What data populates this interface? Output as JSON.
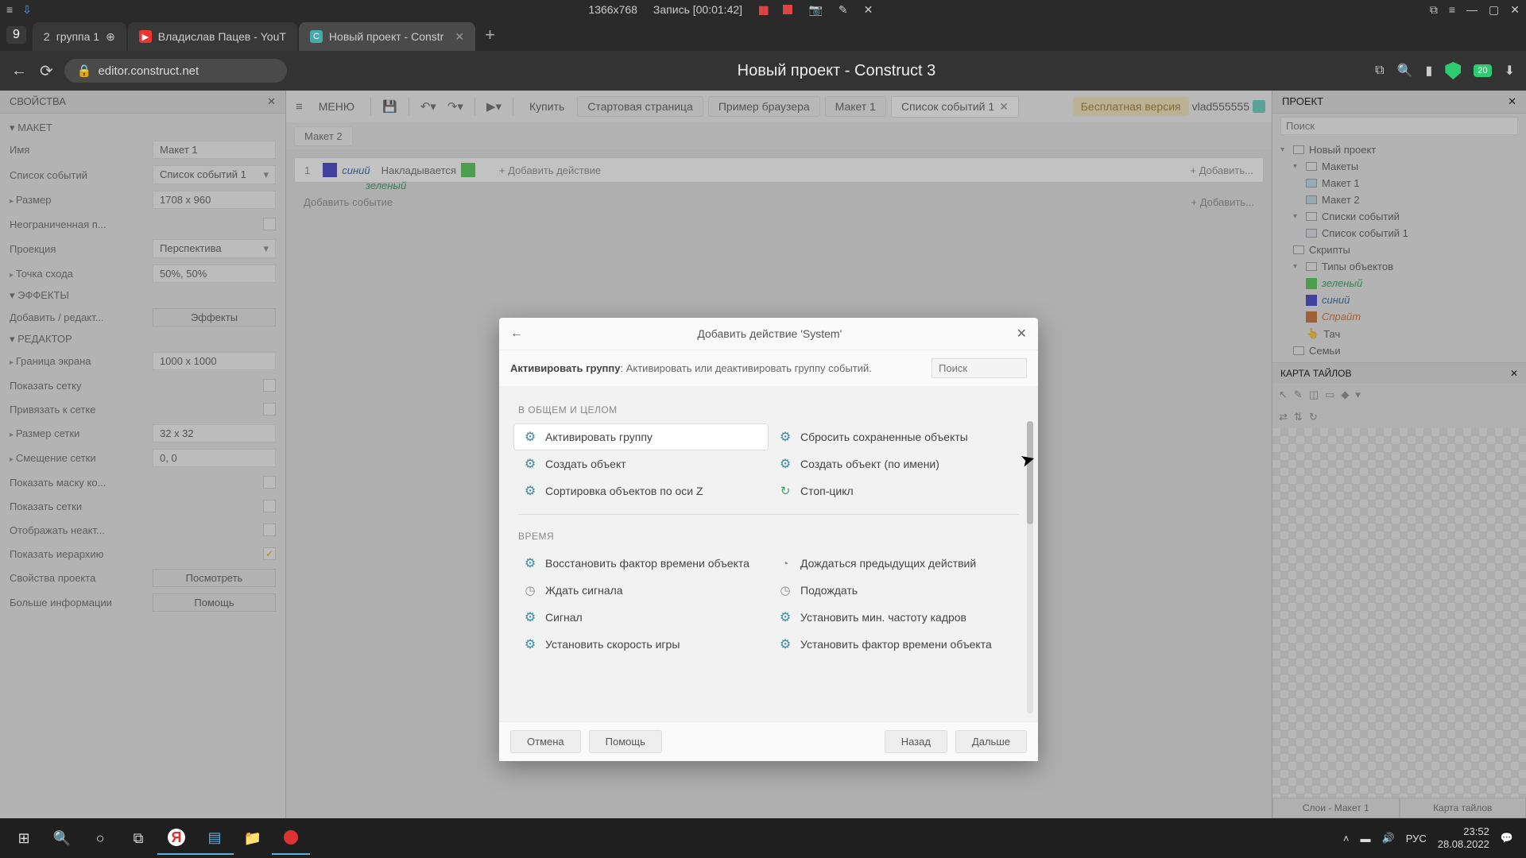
{
  "os": {
    "tabBadge": "9",
    "tabNumLabel": "2",
    "tabGroup": "группа 1",
    "resolution": "1366x768",
    "recordingLabel": "Запись [00:01:42]"
  },
  "browserTabs": {
    "tab1": "Владислав Пацев - YouT",
    "tab2": "Новый проект - Constr"
  },
  "urlBar": {
    "url": "editor.construct.net",
    "pageTitle": "Новый проект - Construct 3",
    "shieldCount": "20"
  },
  "properties": {
    "header": "СВОЙСТВА",
    "sections": {
      "layout": {
        "title": "МАКЕТ",
        "nameLabel": "Имя",
        "nameValue": "Макет 1",
        "eventListLabel": "Список событий",
        "eventListValue": "Список событий 1",
        "sizeLabel": "Размер",
        "sizeValue": "1708 x 960",
        "unboundedLabel": "Неограниченная п...",
        "projectionLabel": "Проекция",
        "projectionValue": "Перспектива",
        "vanishLabel": "Точка схода",
        "vanishValue": "50%, 50%"
      },
      "effects": {
        "title": "ЭФФЕКТЫ",
        "addEditLabel": "Добавить / редакт...",
        "addEditBtn": "Эффекты"
      },
      "editor": {
        "title": "РЕДАКТОР",
        "marginLabel": "Граница экрана",
        "marginValue": "1000 x 1000",
        "showGridLabel": "Показать сетку",
        "snapGridLabel": "Привязать к сетке",
        "gridSizeLabel": "Размер сетки",
        "gridSizeValue": "32 x 32",
        "gridOffsetLabel": "Смещение сетки",
        "gridOffsetValue": "0, 0",
        "showCollisionLabel": "Показать маску ко...",
        "showGridsLabel": "Показать сетки",
        "showInactiveLabel": "Отображать неакт...",
        "showHierarchyLabel": "Показать иерархию",
        "projectPropsLabel": "Свойства проекта",
        "projectPropsBtn": "Посмотреть",
        "moreInfoLabel": "Больше информации",
        "moreInfoBtn": "Помощь"
      }
    }
  },
  "toolbar": {
    "menu": "МЕНЮ",
    "buy": "Купить",
    "startPage": "Стартовая страница",
    "browserExample": "Пример браузера",
    "layout1": "Макет 1",
    "eventSheet1": "Список событий 1",
    "freeEdition": "Бесплатная версия",
    "username": "vlad555555"
  },
  "subTabs": {
    "layout2": "Макет 2"
  },
  "eventSheet": {
    "rowNum": "1",
    "blueSprite": "синий",
    "overlapsLabel": "Накладывается",
    "greenSprite": "зеленый",
    "addActionPlaceholder": "+ Добавить действие",
    "addRight": "+ Добавить...",
    "addEvent": "Добавить событие",
    "addRight2": "+ Добавить..."
  },
  "dialog": {
    "title": "Добавить действие 'System'",
    "descBold": "Активировать группу",
    "descRest": ": Активировать или деактивировать группу событий.",
    "searchPlaceholder": "Поиск",
    "group1": "В ОБЩЕМ И ЦЕЛОМ",
    "actions1": {
      "activateGroup": "Активировать группу",
      "resetPersisted": "Сбросить сохраненные объекты",
      "createObject": "Создать объект",
      "createByName": "Создать объект (по имени)",
      "sortZ": "Сортировка объектов по оси Z",
      "stopLoop": "Стоп-цикл"
    },
    "group2": "ВРЕМЯ",
    "actions2": {
      "restoreTimescale": "Восстановить фактор времени объекта",
      "waitPrevious": "Дождаться предыдущих действий",
      "waitSignal": "Ждать сигнала",
      "wait": "Подождать",
      "signal": "Сигнал",
      "setMinFps": "Установить мин. частоту кадров",
      "setGameSpeed": "Установить скорость игры",
      "setObjectTimescale": "Установить фактор времени объекта"
    },
    "buttons": {
      "cancel": "Отмена",
      "help": "Помощь",
      "back": "Назад",
      "next": "Дальше"
    }
  },
  "project": {
    "header": "ПРОЕКТ",
    "searchPlaceholder": "Поиск",
    "root": "Новый проект",
    "layouts": "Макеты",
    "layout1": "Макет 1",
    "layout2": "Макет 2",
    "eventSheets": "Списки событий",
    "eventSheet1": "Список событий 1",
    "scripts": "Скрипты",
    "objectTypes": "Типы объектов",
    "greenObj": "зеленый",
    "blueObj": "синий",
    "spriteObj": "Спрайт",
    "touchObj": "Тач",
    "families": "Семьи"
  },
  "tilemap": {
    "header": "КАРТА ТАЙЛОВ",
    "footerTab1": "Слои - Макет 1",
    "footerTab2": "Карта тайлов"
  },
  "taskbar": {
    "lang": "РУС",
    "time": "23:52",
    "date": "28.08.2022"
  }
}
